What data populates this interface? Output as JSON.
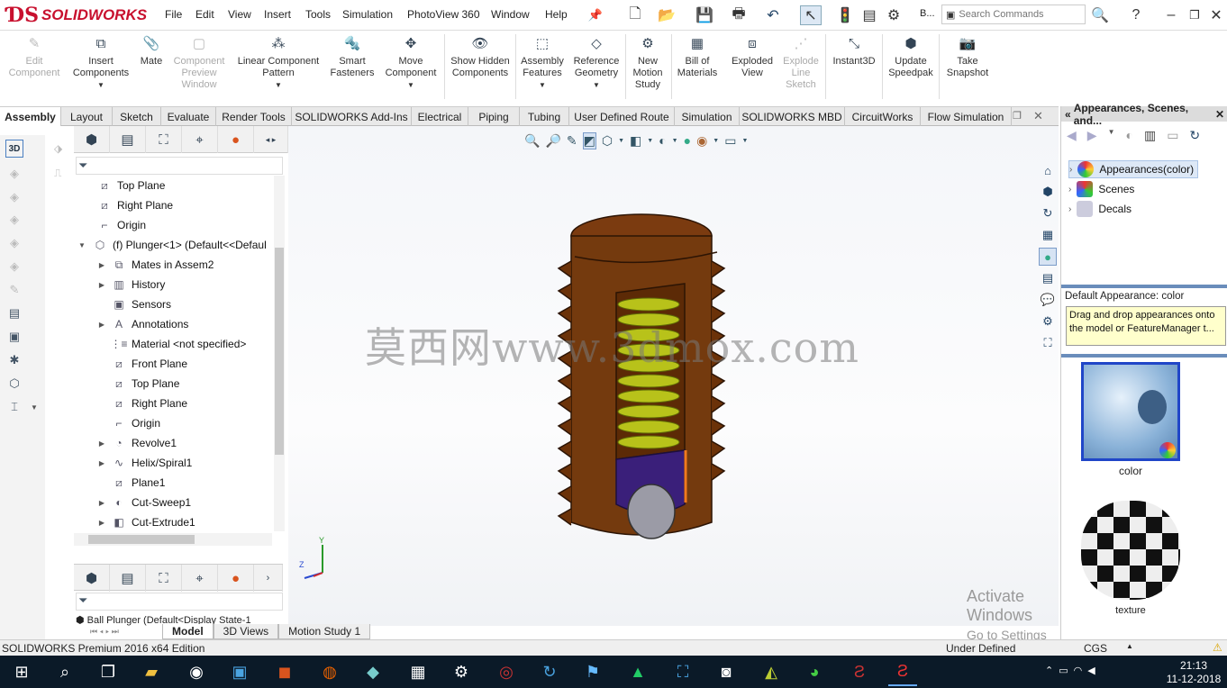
{
  "app": {
    "logo_text": "SOLIDWORKS",
    "edition": "SOLIDWORKS Premium 2016 x64 Edition"
  },
  "menu": [
    "File",
    "Edit",
    "View",
    "Insert",
    "Tools",
    "Simulation",
    "PhotoView 360",
    "Window",
    "Help"
  ],
  "search": {
    "placeholder": "Search Commands",
    "b_label": "B..."
  },
  "toolbar_cmds": [
    {
      "label": "Edit Component",
      "icon": "edit-component-icon",
      "enabled": false
    },
    {
      "label": "Insert Components",
      "icon": "insert-components-icon",
      "enabled": true
    },
    {
      "label": "Mate",
      "icon": "mate-icon",
      "enabled": true
    },
    {
      "label": "Component Preview Window",
      "icon": "preview-window-icon",
      "enabled": false
    },
    {
      "label": "Linear Component Pattern",
      "icon": "linear-pattern-icon",
      "enabled": true
    },
    {
      "label": "Smart Fasteners",
      "icon": "smart-fasteners-icon",
      "enabled": true
    },
    {
      "label": "Move Component",
      "icon": "move-component-icon",
      "enabled": true
    },
    {
      "label": "Show Hidden Components",
      "icon": "show-hidden-icon",
      "enabled": true
    },
    {
      "label": "Assembly Features",
      "icon": "assembly-features-icon",
      "enabled": true
    },
    {
      "label": "Reference Geometry",
      "icon": "reference-geometry-icon",
      "enabled": true
    },
    {
      "label": "New Motion Study",
      "icon": "motion-study-icon",
      "enabled": true
    },
    {
      "label": "Bill of Materials",
      "icon": "bom-icon",
      "enabled": true
    },
    {
      "label": "Exploded View",
      "icon": "exploded-view-icon",
      "enabled": true
    },
    {
      "label": "Explode Line Sketch",
      "icon": "explode-line-icon",
      "enabled": false
    },
    {
      "label": "Instant3D",
      "icon": "instant3d-icon",
      "enabled": true
    },
    {
      "label": "Update Speedpak",
      "icon": "speedpak-icon",
      "enabled": true
    },
    {
      "label": "Take Snapshot",
      "icon": "snapshot-icon",
      "enabled": true
    }
  ],
  "tabs": [
    "Assembly",
    "Layout",
    "Sketch",
    "Evaluate",
    "Render Tools",
    "SOLIDWORKS Add-Ins",
    "Electrical",
    "Piping",
    "Tubing",
    "User Defined Route",
    "Simulation",
    "SOLIDWORKS MBD",
    "CircuitWorks",
    "Flow Simulation"
  ],
  "active_tab": "Assembly",
  "tree": [
    {
      "label": "Top Plane",
      "level": 0,
      "expand": ""
    },
    {
      "label": "Right Plane",
      "level": 0,
      "expand": ""
    },
    {
      "label": "Origin",
      "level": 0,
      "expand": ""
    },
    {
      "label": "(f) Plunger<1> (Default<<Defaul",
      "level": 0,
      "expand": "▼"
    },
    {
      "label": "Mates in Assem2",
      "level": 1,
      "expand": "▶"
    },
    {
      "label": "History",
      "level": 1,
      "expand": "▶"
    },
    {
      "label": "Sensors",
      "level": 1,
      "expand": ""
    },
    {
      "label": "Annotations",
      "level": 1,
      "expand": "▶"
    },
    {
      "label": "Material <not specified>",
      "level": 1,
      "expand": ""
    },
    {
      "label": "Front Plane",
      "level": 1,
      "expand": ""
    },
    {
      "label": "Top Plane",
      "level": 1,
      "expand": ""
    },
    {
      "label": "Right Plane",
      "level": 1,
      "expand": ""
    },
    {
      "label": "Origin",
      "level": 1,
      "expand": ""
    },
    {
      "label": "Revolve1",
      "level": 1,
      "expand": "▶"
    },
    {
      "label": "Helix/Spiral1",
      "level": 1,
      "expand": "▶"
    },
    {
      "label": "Plane1",
      "level": 1,
      "expand": ""
    },
    {
      "label": "Cut-Sweep1",
      "level": 1,
      "expand": "▶"
    },
    {
      "label": "Cut-Extrude1",
      "level": 1,
      "expand": "▶"
    }
  ],
  "lower_panel": {
    "item": "Ball Plunger  (Default<Display State-1"
  },
  "bottom_tabs": [
    "Model",
    "3D Views",
    "Motion Study 1"
  ],
  "watermark": "莫西网www.3dmox.com",
  "task_pane": {
    "title": "Appearances, Scenes, and...",
    "items": [
      "Appearances(color)",
      "Scenes",
      "Decals"
    ],
    "default_label": "Default Appearance: color",
    "tooltip": "Drag and drop appearances onto the model or FeatureManager t...",
    "swatches": [
      {
        "label": "color"
      },
      {
        "label": "texture"
      }
    ]
  },
  "activate": {
    "line1": "Activate Windows",
    "line2": "Go to Settings to activate Windows."
  },
  "status": {
    "state": "Under Defined",
    "units": "CGS"
  },
  "clock": {
    "time": "21:13",
    "date": "11-12-2018"
  },
  "triad": {
    "y": "Y",
    "z": "Z"
  }
}
